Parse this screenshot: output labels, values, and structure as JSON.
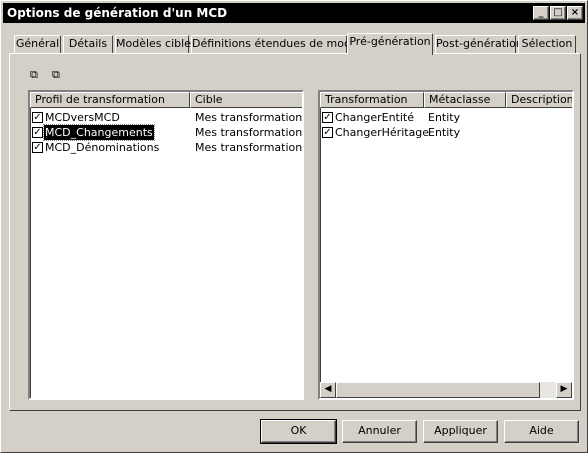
{
  "window": {
    "title": "Options de génération d'un MCD"
  },
  "title_buttons": {
    "minimize": "_",
    "maximize": "□",
    "close": "×"
  },
  "tabs": [
    {
      "label": "Général"
    },
    {
      "label": "Détails"
    },
    {
      "label": "Modèles cible"
    },
    {
      "label": "Définitions étendues de modèle"
    },
    {
      "label": "Pré-génération"
    },
    {
      "label": "Post-génération"
    },
    {
      "label": "Sélection"
    }
  ],
  "toolbar": {
    "select_all_icon": "select-all-icon",
    "deselect_all_icon": "deselect-all-icon"
  },
  "left_list": {
    "columns": [
      "Profil de transformation",
      "Cible"
    ],
    "rows": [
      {
        "name": "MCDversMCD",
        "target": "Mes transformations",
        "checked": true
      },
      {
        "name": "MCD_Changements",
        "target": "Mes transformations",
        "checked": true,
        "selected": true
      },
      {
        "name": "MCD_Dénominations",
        "target": "Mes transformations",
        "checked": true
      }
    ]
  },
  "right_list": {
    "columns": [
      "Transformation",
      "Métaclasse",
      "Description"
    ],
    "rows": [
      {
        "name": "ChangerEntité",
        "metaclass": "Entity",
        "checked": true
      },
      {
        "name": "ChangerHéritage",
        "metaclass": "Entity",
        "checked": true
      }
    ]
  },
  "buttons": {
    "ok": "OK",
    "cancel": "Annuler",
    "apply": "Appliquer",
    "help": "Aide"
  },
  "colors": {
    "titlebar": "#000000",
    "face": "#d4d0c8",
    "selection": "#000000"
  }
}
